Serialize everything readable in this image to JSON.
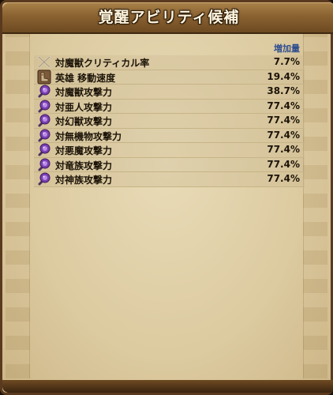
{
  "dialog": {
    "title": "覚醒アビリティ候補"
  },
  "table": {
    "column_header": "増加量",
    "rows": [
      {
        "label": "対魔獣クリティカル率",
        "value": "7.7%",
        "icon": "crossed-swords-icon"
      },
      {
        "label": "英雄 移動速度",
        "value": "19.4%",
        "icon": "boots-icon"
      },
      {
        "label": "対魔獣攻撃力",
        "value": "38.7%",
        "icon": "purple-gem-sword-icon"
      },
      {
        "label": "対亜人攻撃力",
        "value": "77.4%",
        "icon": "purple-gem-sword-icon"
      },
      {
        "label": "対幻獣攻撃力",
        "value": "77.4%",
        "icon": "purple-gem-sword-icon"
      },
      {
        "label": "対無機物攻撃力",
        "value": "77.4%",
        "icon": "purple-gem-sword-icon"
      },
      {
        "label": "対悪魔攻撃力",
        "value": "77.4%",
        "icon": "purple-gem-sword-icon"
      },
      {
        "label": "対竜族攻撃力",
        "value": "77.4%",
        "icon": "purple-gem-sword-icon"
      },
      {
        "label": "対神族攻撃力",
        "value": "77.4%",
        "icon": "purple-gem-sword-icon"
      }
    ]
  },
  "colors": {
    "header_text": "#fff6e0",
    "column_header": "#2f4e8f",
    "parchment": "#e9dcb8",
    "gem": "#7a3fb3"
  }
}
